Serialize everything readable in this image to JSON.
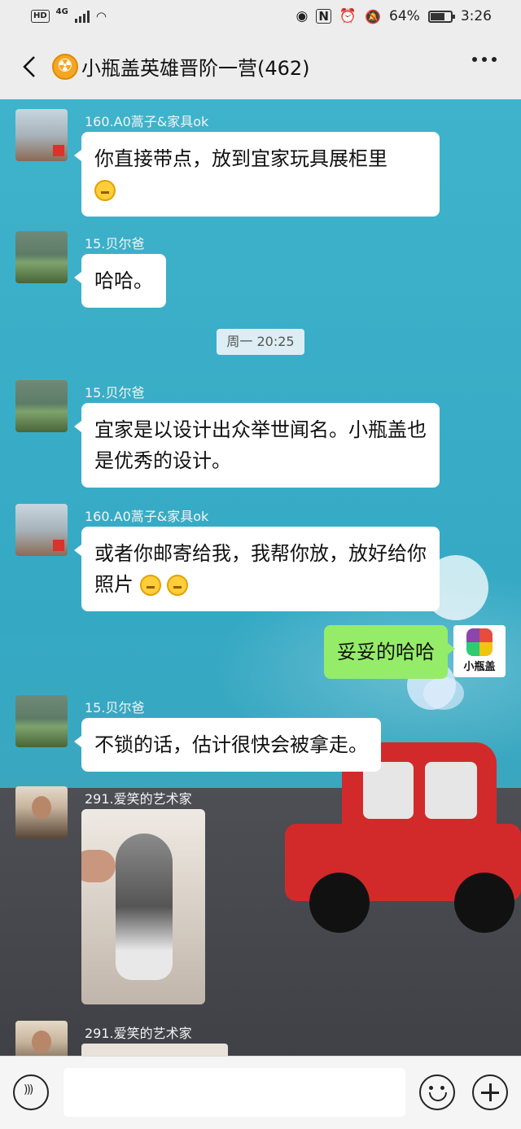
{
  "status_bar": {
    "hd": "HD",
    "network": "4G",
    "battery": "64%",
    "time": "3:26"
  },
  "header": {
    "title": "小瓶盖英雄晋阶一营(462)"
  },
  "timestamp": "周一 20:25",
  "messages": [
    {
      "sender": "160.A0蒿子&家具ok",
      "text": "你直接带点，放到宜家玩具展柜里"
    },
    {
      "sender": "15.贝尔爸",
      "text": "哈哈。"
    },
    {
      "sender": "15.贝尔爸",
      "text": "宜家是以设计出众举世闻名。小瓶盖也是优秀的设计。"
    },
    {
      "sender": "160.A0蒿子&家具ok",
      "text": "或者你邮寄给我，我帮你放，放好给你照片"
    },
    {
      "sender": "me",
      "text": "妥妥的哈哈"
    },
    {
      "sender": "15.贝尔爸",
      "text": "不锁的话，估计很快会被拿走。"
    },
    {
      "sender": "291.爱笑的艺术家",
      "text": ""
    },
    {
      "sender": "291.爱笑的艺术家",
      "text": ""
    }
  ],
  "my_avatar_label": "小瓶盖",
  "input": {
    "placeholder": ""
  },
  "icons": {
    "back": "back-arrow-icon",
    "more": "more-dots-icon",
    "voice": "voice-icon",
    "emoji": "emoji-icon",
    "plus": "plus-icon"
  },
  "colors": {
    "my_bubble": "#95ec69",
    "other_bubble": "#ffffff",
    "chat_bg": "#3fb3cb"
  }
}
